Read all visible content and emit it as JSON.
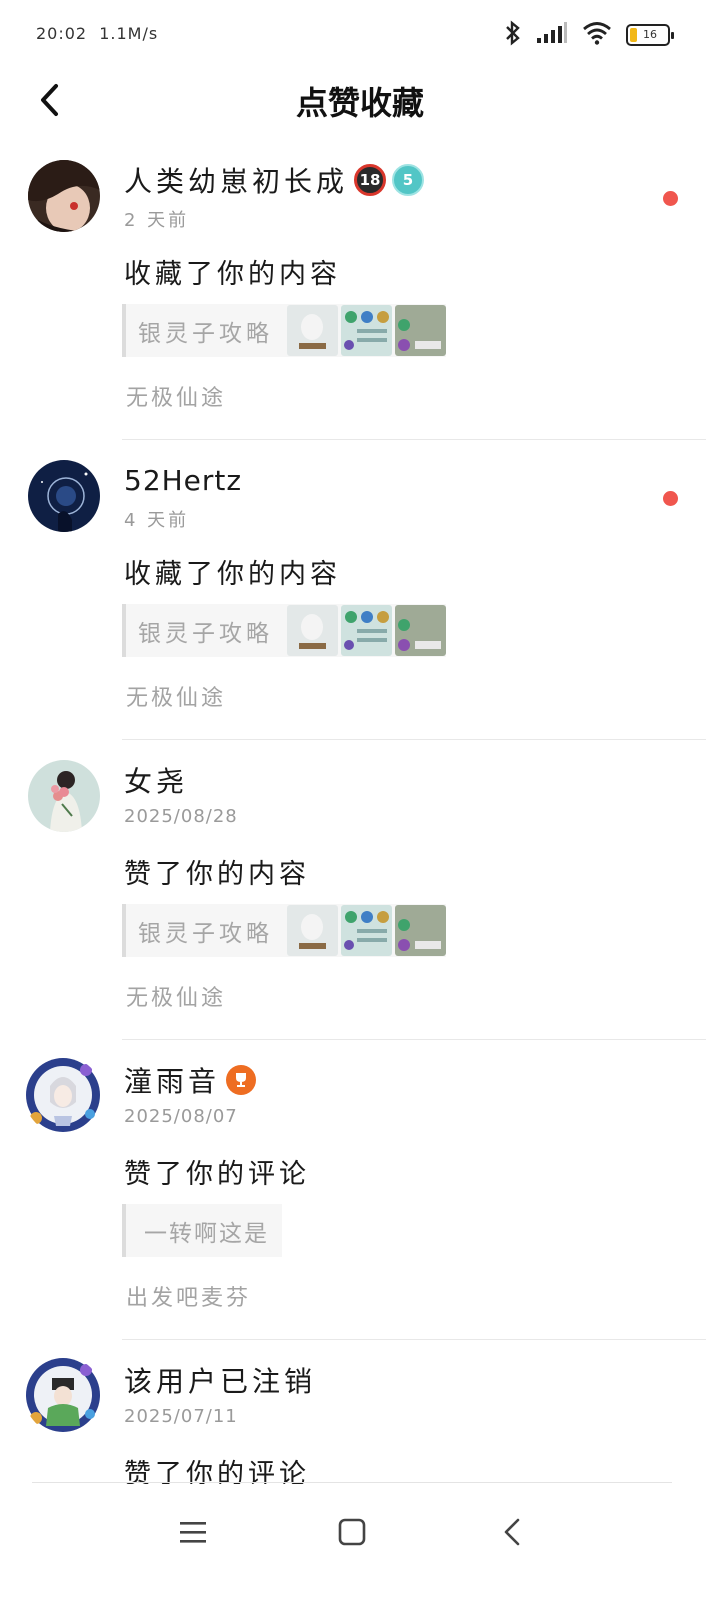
{
  "status_bar": {
    "time": "20:02",
    "speed": "1.1M/s",
    "battery": "16"
  },
  "header": {
    "title": "点赞收藏"
  },
  "notices": [
    {
      "username": "人类幼崽初长成",
      "badges": [
        "18",
        "5"
      ],
      "time": "2 天前",
      "action": "收藏了你的内容",
      "content_title": "银灵子攻略",
      "topic": "无极仙途",
      "unread": true
    },
    {
      "username": "52Hertz",
      "time": "4 天前",
      "action": "收藏了你的内容",
      "content_title": "银灵子攻略",
      "topic": "无极仙途",
      "unread": true
    },
    {
      "username": "女尧",
      "time": "2025/08/28",
      "action": "赞了你的内容",
      "content_title": "银灵子攻略",
      "topic": "无极仙途",
      "unread": false
    },
    {
      "username": "潼雨音",
      "time": "2025/08/07",
      "action": "赞了你的评论",
      "comment_text": "一转啊这是",
      "topic": "出发吧麦芬",
      "unread": false
    },
    {
      "username": "该用户已注销",
      "time": "2025/07/11",
      "action": "赞了你的评论",
      "unread": false
    }
  ],
  "colors": {
    "unread_dot": "#f0564e",
    "secondary_text": "#9a9a9a",
    "card_bg": "#f6f6f6"
  }
}
